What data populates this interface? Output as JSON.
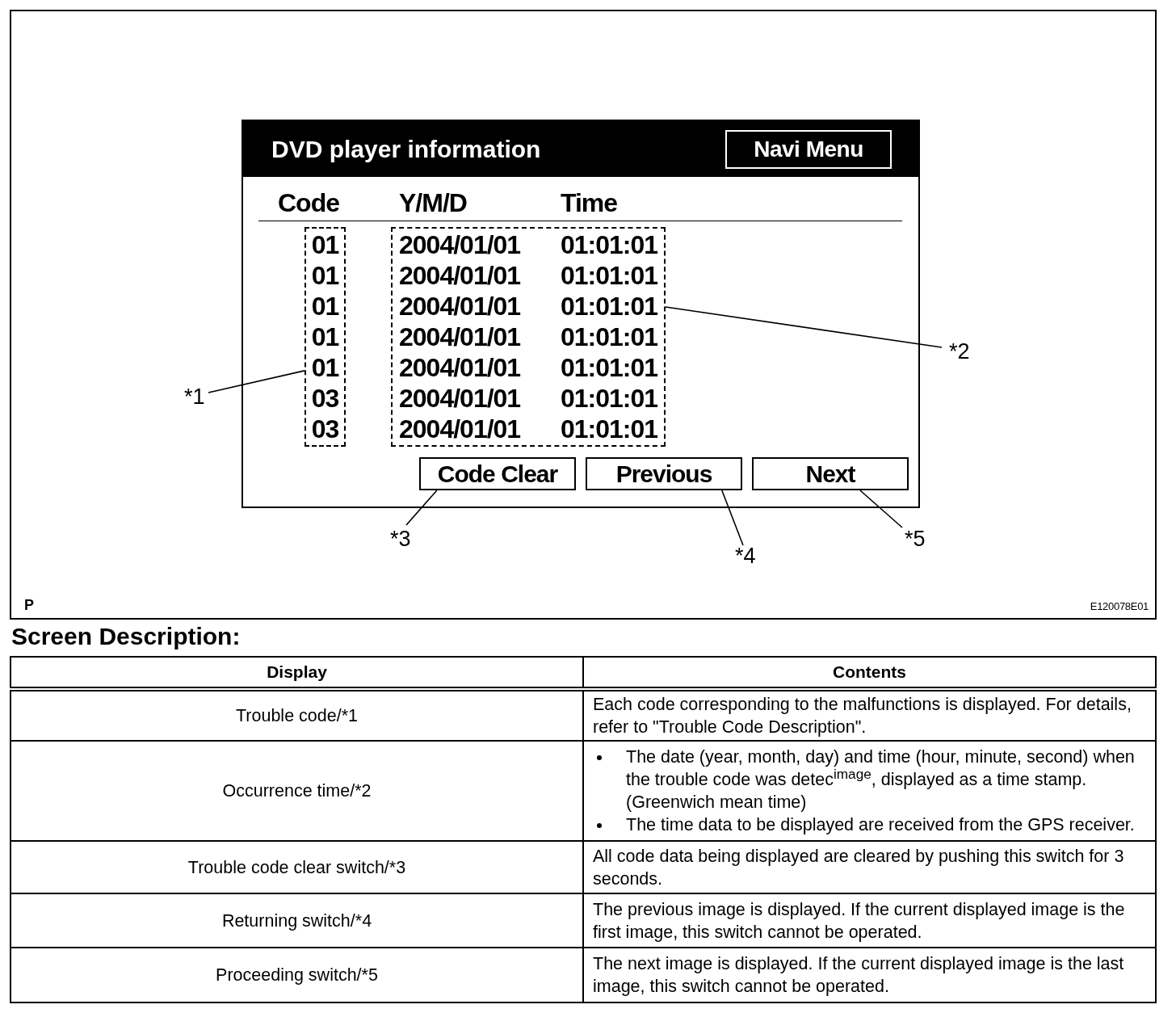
{
  "figure": {
    "screen": {
      "title": "DVD player information",
      "menu_button": "Navi Menu",
      "columns": [
        "Code",
        "Y/M/D",
        "Time"
      ],
      "code_callout": "*1",
      "record_callout": "*2",
      "rows": [
        {
          "code": "01",
          "date": "2004/01/01",
          "time": "01:01:01"
        },
        {
          "code": "01",
          "date": "2004/01/01",
          "time": "01:01:01"
        },
        {
          "code": "01",
          "date": "2004/01/01",
          "time": "01:01:01"
        },
        {
          "code": "01",
          "date": "2004/01/01",
          "time": "01:01:01"
        },
        {
          "code": "01",
          "date": "2004/01/01",
          "time": "01:01:01"
        },
        {
          "code": "03",
          "date": "2004/01/01",
          "time": "01:01:01"
        },
        {
          "code": "03",
          "date": "2004/01/01",
          "time": "01:01:01"
        }
      ],
      "buttons": [
        {
          "label": "Code Clear",
          "callout": "*3"
        },
        {
          "label": "Previous",
          "callout": "*4"
        },
        {
          "label": "Next",
          "callout": "*5"
        }
      ]
    },
    "corner_mark": "P",
    "figure_id": "E120078E01"
  },
  "section_title": "Screen Description:",
  "table": {
    "columns": [
      "Display",
      "Contents"
    ],
    "rows": [
      {
        "display": "Trouble code/*1",
        "contents": {
          "kind": "text",
          "text": "Each code corresponding to the malfunctions is displayed. For details, refer to \"Trouble Code Description\"."
        }
      },
      {
        "display": "Occurrence time/*2",
        "contents": {
          "kind": "bullets",
          "items": [
            "The date (year, month, day) and time (hour, minute, second) when the trouble code was detec$^{image}$, displayed as a time stamp. (Greenwich mean time)",
            "The time data to be displayed are received from the GPS receiver."
          ]
        }
      },
      {
        "display": "Trouble code clear switch/*3",
        "contents": {
          "kind": "text",
          "text": "All code data being displayed are cleared by pushing this switch for 3 seconds."
        }
      },
      {
        "display": "Returning switch/*4",
        "contents": {
          "kind": "text",
          "text": "The previous image is displayed. If the current displayed image is the first image, this switch cannot be operated."
        }
      },
      {
        "display": "Proceeding switch/*5",
        "contents": {
          "kind": "text",
          "text": "The next image is displayed. If the current displayed image is the last image, this switch cannot be operated."
        }
      }
    ]
  }
}
